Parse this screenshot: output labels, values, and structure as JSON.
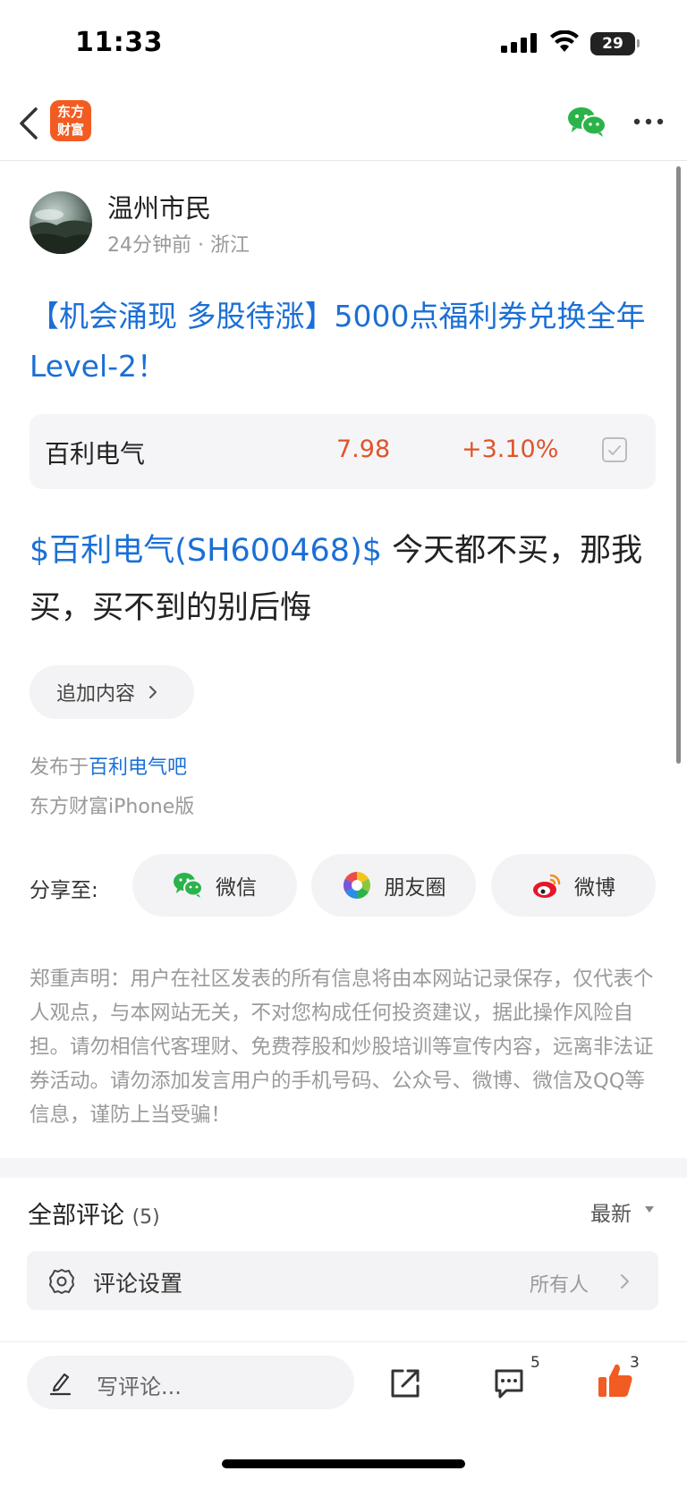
{
  "status_bar": {
    "time": "11:33",
    "battery": "29"
  },
  "nav": {
    "logo_line1": "东方",
    "logo_line2": "财富"
  },
  "post": {
    "author": "温州市民",
    "meta": "24分钟前 · 浙江",
    "title": "【机会涌现 多股待涨】5000点福利券兑换全年Level-2！",
    "stock_card": {
      "name": "百利电气",
      "price": "7.98",
      "change": "+3.10%"
    },
    "body_link": "$百利电气(SH600468)$",
    "body_text": " 今天都不买，那我买，买不到的别后悔",
    "add_content_label": "追加内容",
    "publish_prefix": "发布于",
    "forum_name": "百利电气吧",
    "client": "东方财富iPhone版"
  },
  "share": {
    "label": "分享至:",
    "wechat": "微信",
    "moments": "朋友圈",
    "weibo": "微博"
  },
  "disclaimer": "郑重声明：用户在社区发表的所有信息将由本网站记录保存，仅代表个人观点，与本网站无关，不对您构成任何投资建议，据此操作风险自担。请勿相信代客理财、免费荐股和炒股培训等宣传内容，远离非法证券活动。请勿添加发言用户的手机号码、公众号、微博、微信及QQ等信息，谨防上当受骗！",
  "comments": {
    "title": "全部评论",
    "count": "(5)",
    "sort": "最新",
    "settings_label": "评论设置",
    "settings_value": "所有人"
  },
  "bottom_bar": {
    "compose_placeholder": "写评论...",
    "comment_count": "5",
    "like_count": "3"
  },
  "colors": {
    "brand": "#f25c22",
    "link": "#1b6fd6",
    "up": "#e0532b"
  }
}
